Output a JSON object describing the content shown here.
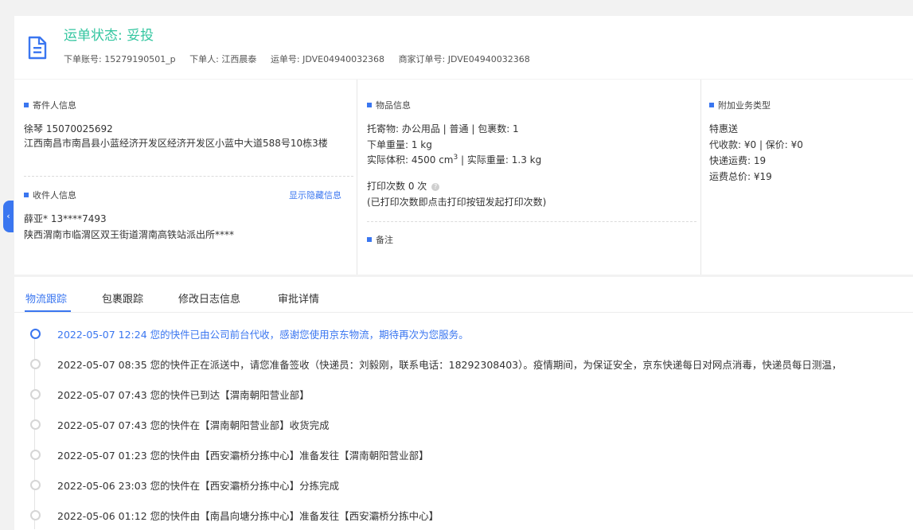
{
  "header": {
    "status": "运单状态: 妥投",
    "order_account": "下单账号: 15279190501_p",
    "orderer": "下单人: 江西晨泰",
    "waybill_no": "运单号: JDVE04940032368",
    "merchant_order_no": "商家订单号: JDVE04940032368",
    "icon": "document-icon"
  },
  "sender": {
    "title": "寄件人信息",
    "name_phone": "徐琴   15070025692",
    "address": "江西南昌市南昌县小蓝经济开发区经济开发区小蓝中大道588号10栋3楼"
  },
  "receiver": {
    "title": "收件人信息",
    "show_hidden": "显示隐藏信息",
    "name_phone": "薛亚*   13****7493",
    "address": "陕西渭南市临渭区双王街道渭南高铁站派出所****"
  },
  "goods": {
    "title": "物品信息",
    "item": "托寄物: 办公用品 | 普通 | 包裹数: 1",
    "order_weight": "下单重量:  1 kg",
    "volume_prefix": "实际体积:   4500 cm",
    "volume_sup": "3",
    "volume_suffix": " | 实际重量:  1.3 kg",
    "print_count": "打印次数   0 次",
    "print_note": "(已打印次数即点击打印按钮发起打印次数)",
    "remark_title": "备注"
  },
  "service": {
    "title": "附加业务类型",
    "type": "特惠送",
    "cod": "代收款:  ¥0  |  保价:  ¥0",
    "freight": "快递运费:  19",
    "total": "运费总价:  ¥19"
  },
  "tabs": [
    {
      "label": "物流跟踪",
      "active": true
    },
    {
      "label": "包裹跟踪"
    },
    {
      "label": "修改日志信息"
    },
    {
      "label": "审批详情"
    }
  ],
  "tracking": [
    {
      "text": "2022-05-07 12:24 您的快件已由公司前台代收，感谢您使用京东物流，期待再次为您服务。",
      "active": true
    },
    {
      "text": "2022-05-07 08:35 您的快件正在派送中，请您准备签收（快递员：刘毅刚，联系电话：18292308403）。疫情期间，为保证安全，京东快递每日对网点消毒，快递员每日测温，"
    },
    {
      "text": "2022-05-07 07:43 您的快件已到达【渭南朝阳营业部】"
    },
    {
      "text": "2022-05-07 07:43 您的快件在【渭南朝阳营业部】收货完成"
    },
    {
      "text": "2022-05-07 01:23 您的快件由【西安灞桥分拣中心】准备发往【渭南朝阳营业部】"
    },
    {
      "text": "2022-05-06 23:03 您的快件在【西安灞桥分拣中心】分拣完成"
    },
    {
      "text": "2022-05-06 01:12 您的快件由【南昌向塘分拣中心】准备发往【西安灞桥分拣中心】"
    }
  ],
  "colors": {
    "status_green": "#34c6a0",
    "accent_blue": "#3a76f0"
  }
}
